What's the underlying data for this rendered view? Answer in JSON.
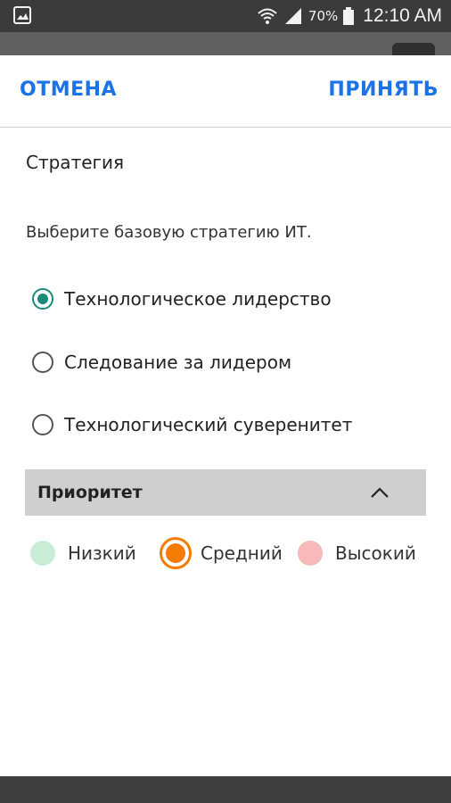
{
  "status_bar": {
    "battery_percent": "70%",
    "time": "12:10 AM",
    "icons": [
      "gallery-icon",
      "wifi-icon",
      "signal-icon",
      "battery-icon"
    ]
  },
  "dialog": {
    "cancel_label": "ОТМЕНА",
    "accept_label": "ПРИНЯТЬ",
    "section_title": "Стратегия",
    "question": "Выберите базовую стратегию ИТ.",
    "options": [
      {
        "label": "Технологическое лидерство",
        "checked": true
      },
      {
        "label": "Следование за лидером",
        "checked": false
      },
      {
        "label": "Технологический суверенитет",
        "checked": false
      }
    ],
    "priority": {
      "title": "Приоритет",
      "levels": [
        {
          "label": "Низкий",
          "color": "#c8ecd6",
          "selected": false
        },
        {
          "label": "Средний",
          "color": "#f57c00",
          "selected": true
        },
        {
          "label": "Высокий",
          "color": "#f7b9b9",
          "selected": false
        }
      ]
    }
  },
  "colors": {
    "accent_blue": "#1a73e8",
    "radio_teal": "#1a8a7a"
  }
}
